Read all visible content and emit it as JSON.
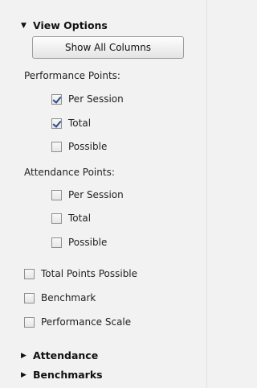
{
  "view_options": {
    "title": "View Options",
    "show_all_columns_label": "Show All Columns",
    "performance": {
      "label": "Performance Points:",
      "items": [
        {
          "label": "Per Session",
          "checked": true
        },
        {
          "label": "Total",
          "checked": true
        },
        {
          "label": "Possible",
          "checked": false
        }
      ]
    },
    "attendance": {
      "label": "Attendance Points:",
      "items": [
        {
          "label": "Per Session",
          "checked": false
        },
        {
          "label": "Total",
          "checked": false
        },
        {
          "label": "Possible",
          "checked": false
        }
      ]
    },
    "extra_items": [
      {
        "label": "Total Points Possible",
        "checked": false
      },
      {
        "label": "Benchmark",
        "checked": false
      },
      {
        "label": "Performance Scale",
        "checked": false
      }
    ]
  },
  "attendance_section": {
    "title": "Attendance"
  },
  "benchmarks_section": {
    "title": "Benchmarks"
  },
  "icons": {
    "expanded": "triangle-down",
    "collapsed": "triangle-right"
  }
}
